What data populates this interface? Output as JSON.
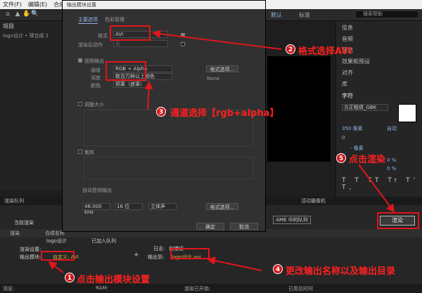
{
  "menubar": [
    "文件(F)",
    "编辑(E)",
    "合成(C)"
  ],
  "dialog": {
    "title": "输出模块设置",
    "tabs": [
      "主要选项",
      "色彩管理"
    ],
    "format_label": "格式",
    "format_value": "AVI",
    "render_after_label": "渲染后动作",
    "render_after_value": "无",
    "video_output_label": "视频输出",
    "channels_label": "通道",
    "channels_value": "RGB + Alpha",
    "depth_label": "深度",
    "depth_value": "数百万种以上颜色",
    "color_label": "颜色",
    "color_value": "预乘（遮罩）",
    "format_options_btn": "格式选项...",
    "none_label": "None",
    "resize_label": "调整大小",
    "crop_label": "裁剪",
    "audio_label": "自动音频输出",
    "audio_rate": "48.000 kHz",
    "audio_bits": "16 位",
    "audio_ch": "立体声",
    "audio_format_btn": "格式选项...",
    "ok": "确定",
    "cancel": "取消"
  },
  "toolbar": {
    "ws1": "默认",
    "ws2": "标准",
    "search": "搜索帮助"
  },
  "left": {
    "project": "项目",
    "comp": "logo设计 • 预合成 1"
  },
  "right": {
    "items": [
      "信息",
      "音频",
      "预览",
      "效果和预设",
      "对齐",
      "库",
      "字符"
    ],
    "font": "方正粗倩_GBK",
    "size1": "350 像素",
    "size2": "自动",
    "size3": "- 像素",
    "size4": "0",
    "p1": "0 %",
    "p2": "0 %"
  },
  "bottom": {
    "render_queue": "渲染队列",
    "current": "当前渲染",
    "comp_col": "合成名称",
    "render_tab": "渲染",
    "comp_name": "logo设计",
    "status": "已加入队列",
    "render_settings": "渲染设置:",
    "output_module_label": "输出模块:",
    "output_module_value": "自定义: AVI",
    "log_label": "日志:",
    "log_value": "仅错误",
    "output_to_label": "输出到:",
    "output_to_value": "logo设计.avi",
    "ame_btn": "AME 中的队列",
    "render_btn": "渲染",
    "camera": "活动摄像机"
  },
  "status": {
    "message": "消息:",
    "ram": "RAM:",
    "started": "渲染已开始:",
    "elapsed": "已用总时间"
  },
  "annotations": {
    "a1": "点击输出模块设置",
    "a2": "格式选择AVI",
    "a3": "通道选择【rgb+alpha】",
    "a4": "更改输出名称以及输出目录",
    "a5": "点击渲染"
  },
  "numbers": {
    "n1": "1",
    "n2": "2",
    "n3": "3",
    "n4": "4",
    "n5": "5"
  },
  "colors": {
    "accent": "#e0161c"
  }
}
